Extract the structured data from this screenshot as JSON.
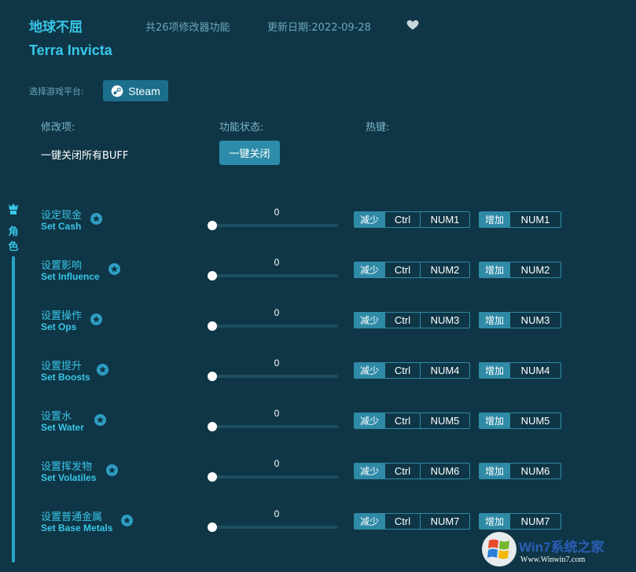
{
  "header": {
    "title_cn": "地球不屈",
    "title_en": "Terra Invicta",
    "feature_count": "共26项修改器功能",
    "update_date": "更新日期:2022-09-28"
  },
  "platform": {
    "label": "选择游戏平台:",
    "steam_label": "Steam"
  },
  "columns": {
    "mod": "修改项:",
    "status": "功能状态:",
    "hotkey": "热键:"
  },
  "buff": {
    "label": "一键关闭所有BUFF",
    "button": "一键关闭"
  },
  "sidebar": {
    "category": "角色"
  },
  "rows": [
    {
      "cn": "设定现金",
      "en": "Set Cash",
      "value": "0",
      "dec": "减少",
      "mod": "Ctrl",
      "dec_key": "NUM1",
      "inc": "增加",
      "inc_key": "NUM1"
    },
    {
      "cn": "设置影响",
      "en": "Set Influence",
      "value": "0",
      "dec": "减少",
      "mod": "Ctrl",
      "dec_key": "NUM2",
      "inc": "增加",
      "inc_key": "NUM2"
    },
    {
      "cn": "设置操作",
      "en": "Set Ops",
      "value": "0",
      "dec": "减少",
      "mod": "Ctrl",
      "dec_key": "NUM3",
      "inc": "增加",
      "inc_key": "NUM3"
    },
    {
      "cn": "设置提升",
      "en": "Set Boosts",
      "value": "0",
      "dec": "减少",
      "mod": "Ctrl",
      "dec_key": "NUM4",
      "inc": "增加",
      "inc_key": "NUM4"
    },
    {
      "cn": "设置水",
      "en": "Set Water",
      "value": "0",
      "dec": "减少",
      "mod": "Ctrl",
      "dec_key": "NUM5",
      "inc": "增加",
      "inc_key": "NUM5"
    },
    {
      "cn": "设置挥发物",
      "en": "Set Volatiles",
      "value": "0",
      "dec": "减少",
      "mod": "Ctrl",
      "dec_key": "NUM6",
      "inc": "增加",
      "inc_key": "NUM6"
    },
    {
      "cn": "设置普通金属",
      "en": "Set Base Metals",
      "value": "0",
      "dec": "减少",
      "mod": "Ctrl",
      "dec_key": "NUM7",
      "inc": "增加",
      "inc_key": "NUM7"
    }
  ],
  "watermark": {
    "brand": "Win7系统之家",
    "url": "Www.Winwin7.com"
  },
  "colors": {
    "background": "#0f3646",
    "accent": "#38c6e8",
    "button": "#2d8caa"
  },
  "icons": {
    "heart": "heart-icon",
    "steam": "steam-icon",
    "star": "star-icon",
    "sidebar": "character-icon"
  }
}
